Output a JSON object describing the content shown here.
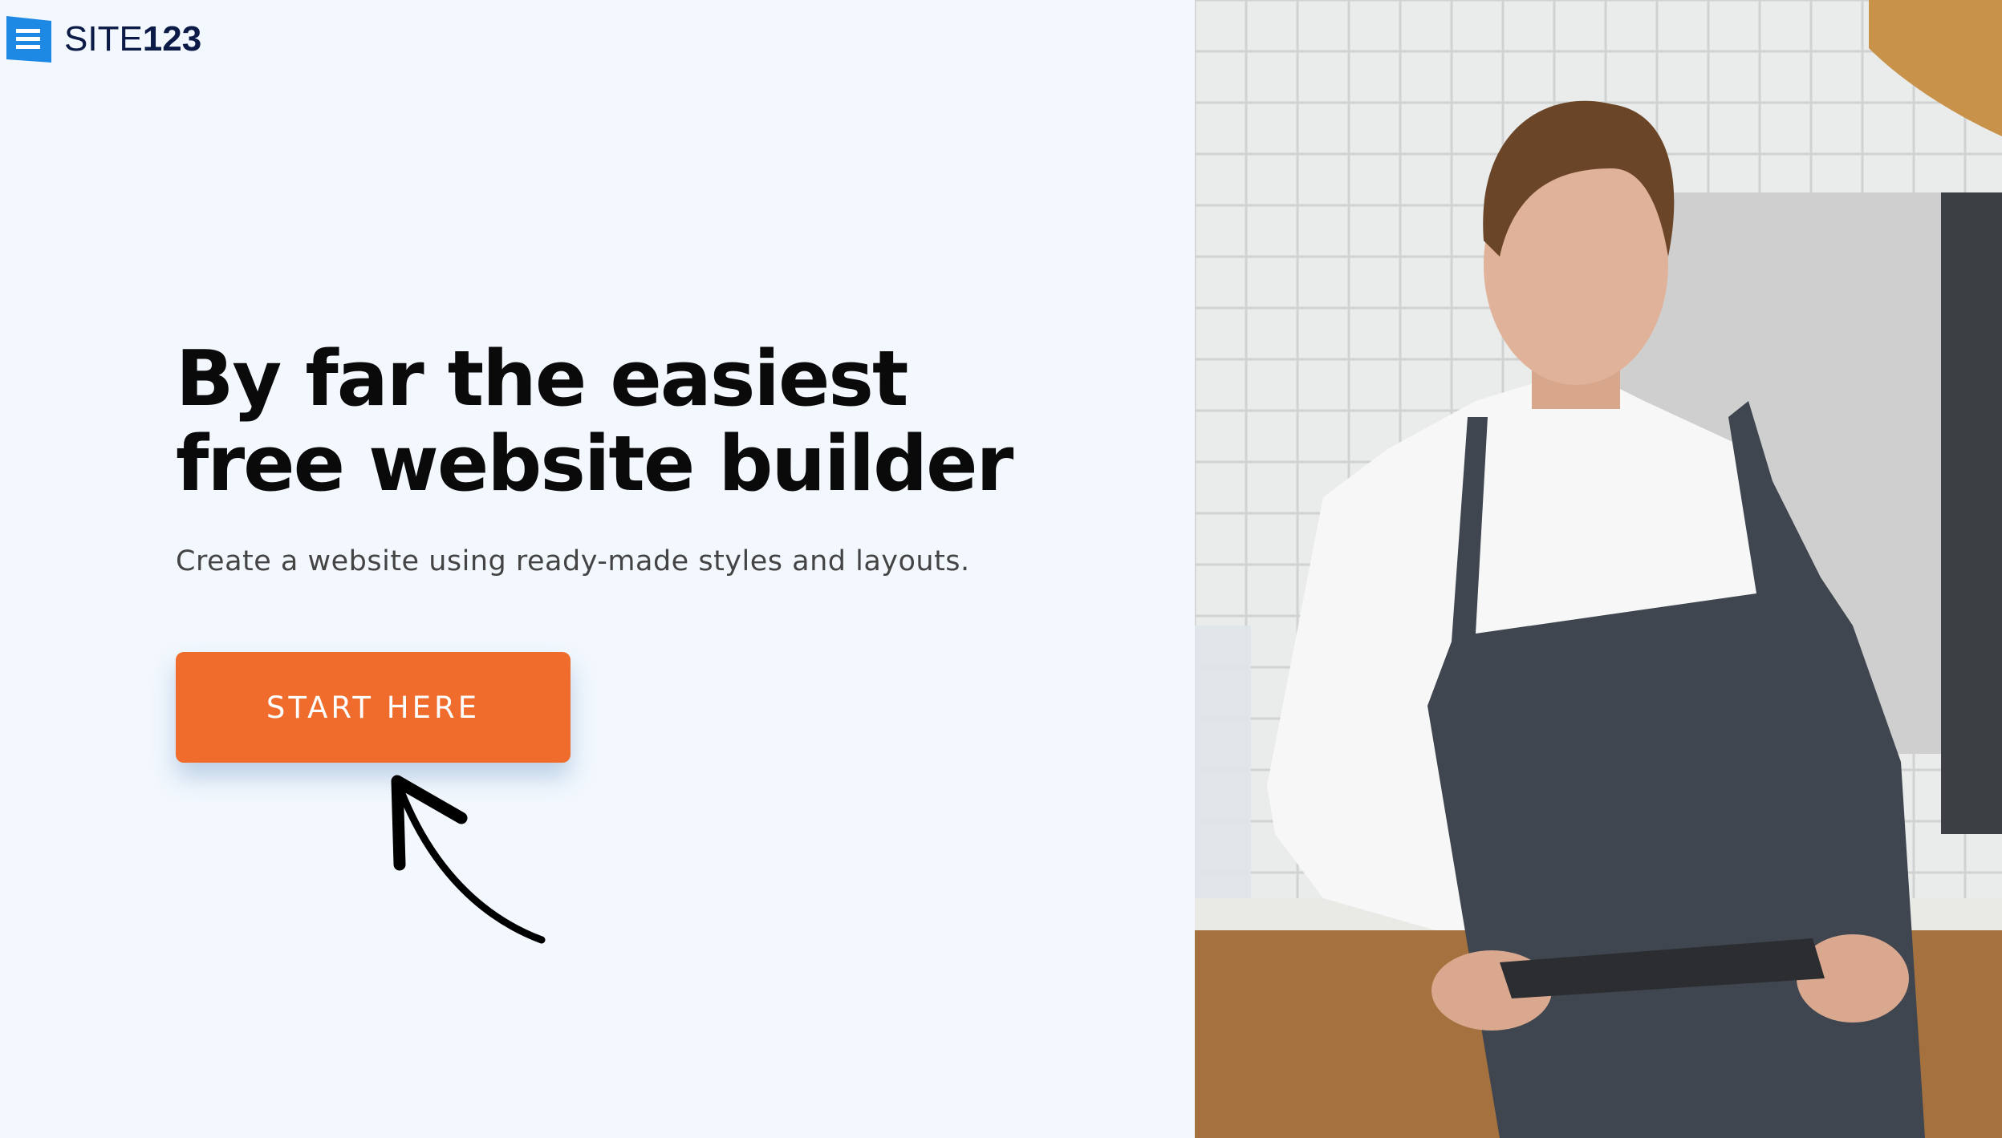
{
  "brand": {
    "name_light": "SITE",
    "name_bold": "123",
    "accent": "#1e88e5"
  },
  "hero": {
    "title_line1": "By far the easiest",
    "title_line2": "free website builder",
    "subtitle": "Create a website using ready-made styles and layouts.",
    "cta_label": "START HERE",
    "cta_color": "#f06c2d"
  }
}
